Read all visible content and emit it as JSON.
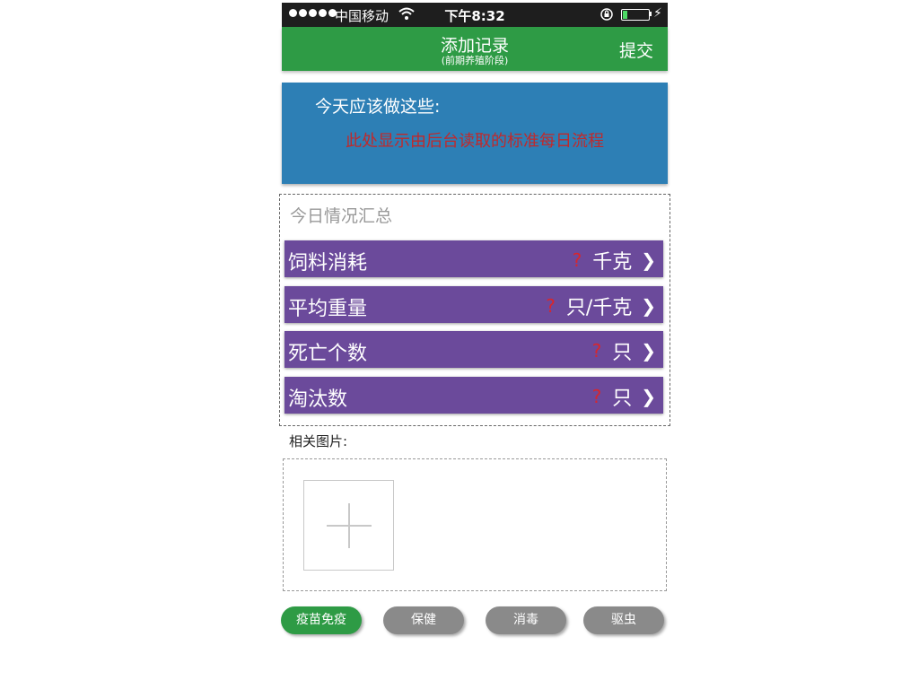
{
  "status_bar": {
    "carrier": "中国移动",
    "time": "下午8:32",
    "battery_level": 0.18,
    "icons": [
      "signal-dots-icon",
      "wifi-icon",
      "orientation-lock-icon",
      "battery-icon",
      "charging-bolt-icon"
    ]
  },
  "nav": {
    "title": "添加记录",
    "subtitle": "(前期养殖阶段)",
    "submit_label": "提交"
  },
  "today": {
    "heading": "今天应该做这些:",
    "body": "此处显示由后台读取的标准每日流程"
  },
  "summary": {
    "title": "今日情况汇总",
    "rows": [
      {
        "label": "饲料消耗",
        "value": "?",
        "unit": "千克",
        "chevron": "❯"
      },
      {
        "label": "平均重量",
        "value": "?",
        "unit": "只/千克",
        "chevron": "❯"
      },
      {
        "label": "死亡个数",
        "value": "?",
        "unit": "只",
        "chevron": "❯"
      },
      {
        "label": "淘汰数",
        "value": "?",
        "unit": "只",
        "chevron": "❯"
      }
    ]
  },
  "photos": {
    "label": "相关图片:"
  },
  "bottom_buttons": [
    {
      "label": "疫苗免疫",
      "active": true
    },
    {
      "label": "保健",
      "active": false
    },
    {
      "label": "消毒",
      "active": false
    },
    {
      "label": "驱虫",
      "active": false
    }
  ],
  "colors": {
    "nav_green": "#2e9b45",
    "panel_blue": "#2d7fb5",
    "row_purple": "#6b4a9b",
    "alert_red": "#c0292b",
    "button_gray": "#8a8a8a"
  }
}
